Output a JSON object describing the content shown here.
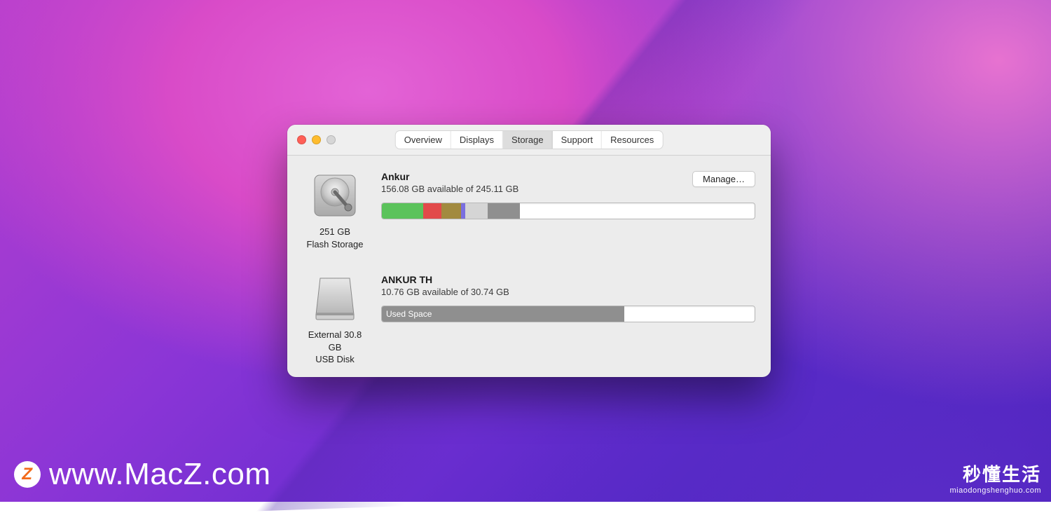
{
  "tabs": {
    "overview": "Overview",
    "displays": "Displays",
    "storage": "Storage",
    "support": "Support",
    "resources": "Resources",
    "active": "storage"
  },
  "drives": [
    {
      "name": "Ankur",
      "available_text": "156.08 GB available of 245.11 GB",
      "caption_line1": "251 GB",
      "caption_line2": "Flash Storage",
      "manage_label": "Manage…",
      "show_manage": true,
      "icon": "internal-hdd",
      "segments": [
        {
          "label": "",
          "width_pct": 11.1,
          "color": "#5bc35b"
        },
        {
          "label": "",
          "width_pct": 4.8,
          "color": "#e24a4a"
        },
        {
          "label": "",
          "width_pct": 5.3,
          "color": "#a28a3f"
        },
        {
          "label": "",
          "width_pct": 0.9,
          "color": "#7a6fe0"
        },
        {
          "label": "",
          "width_pct": 6.0,
          "color": "#d5d5d5"
        },
        {
          "label": "",
          "width_pct": 8.7,
          "color": "#8f8f8f"
        }
      ]
    },
    {
      "name": "ANKUR TH",
      "available_text": "10.76 GB available of 30.74 GB",
      "caption_line1": "External 30.8 GB",
      "caption_line2": "USB Disk",
      "show_manage": false,
      "icon": "external-disk",
      "segments": [
        {
          "label": "Used Space",
          "width_pct": 65.0,
          "color": "#8f8f8f"
        }
      ]
    }
  ],
  "watermarks": {
    "left_text": "www.MacZ.com",
    "left_logo_letter": "Z",
    "right_cn": "秒懂生活",
    "right_url": "miaodongshenghuo.com"
  }
}
